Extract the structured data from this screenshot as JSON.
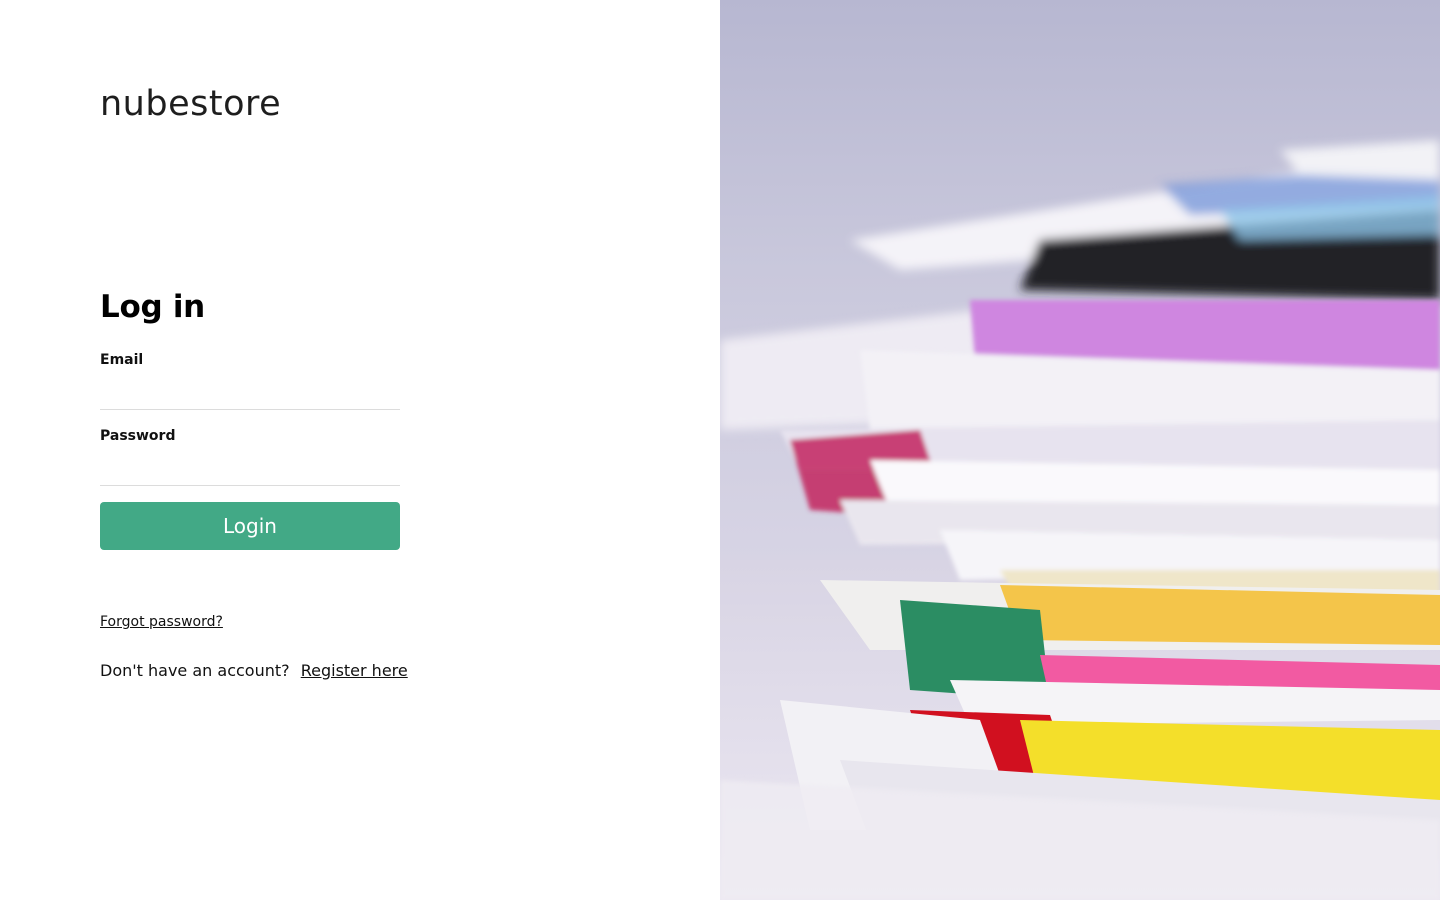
{
  "brand": {
    "name": "nubestore"
  },
  "login": {
    "title": "Log in",
    "email_label": "Email",
    "email_value": "",
    "password_label": "Password",
    "password_value": "",
    "button_label": "Login"
  },
  "links": {
    "forgot_password": "Forgot password?",
    "no_account_text": "Don't have an account?",
    "register": "Register here"
  },
  "colors": {
    "accent": "#42a986",
    "text": "#111111",
    "input_border": "#dcdcdc"
  },
  "hero_image": {
    "description_icon": "paper-stack-image"
  }
}
